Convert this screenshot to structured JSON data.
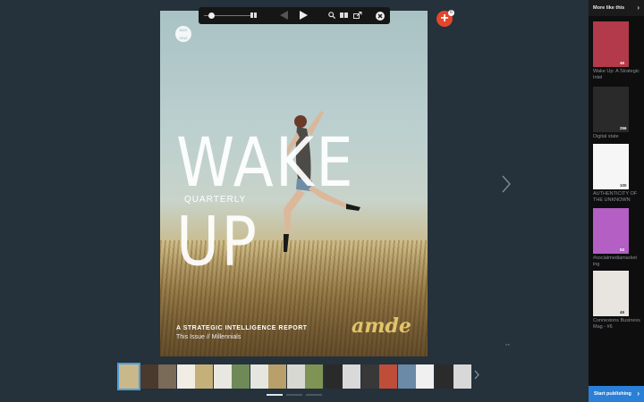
{
  "cover": {
    "date_badge": "AUG 2012",
    "title": "WAKE UP",
    "subtitle": "QUARTERLY",
    "footer_line1": "A STRATEGIC INTELLIGENCE REPORT",
    "footer_line2": "This Issue // Millennials",
    "brand": "amde"
  },
  "toolbar": {
    "icons": [
      "zoom-slider",
      "grid-icon",
      "prev-page-icon",
      "play-icon",
      "search-icon",
      "pages-icon",
      "share-icon",
      "close-icon"
    ]
  },
  "add_badge": "6",
  "thumbnails": {
    "count": 10,
    "colors": [
      [
        "#c9b889",
        "#c9b889"
      ],
      [
        "#4a3a2d",
        "#7a6a58"
      ],
      [
        "#f1ede4",
        "#c6b07a"
      ],
      [
        "#e9e7e1",
        "#6f8a58"
      ],
      [
        "#e6e6e0",
        "#b9a06a"
      ],
      [
        "#d8d8d2",
        "#7f9355"
      ],
      [
        "#2a2a2a",
        "#d9d9d9"
      ],
      [
        "#383838",
        "#bf4d3a"
      ],
      [
        "#6a8aa8",
        "#f0f0f0"
      ],
      [
        "#2b2b2b",
        "#d8d8d8"
      ]
    ],
    "pager_dots": 3
  },
  "sidebar": {
    "header": "More like this",
    "items": [
      {
        "title": "Wake Up: A Strategic Intel",
        "count": "46",
        "color": "#b33a4a"
      },
      {
        "title": "Digital state",
        "count": "256",
        "color": "#2a2a2a"
      },
      {
        "title": "AUTHENTICITY OF THE UNKNOWN",
        "count": "100",
        "color": "#f6f6f6"
      },
      {
        "title": "#socialmediamarket ing",
        "count": "53",
        "color": "#b35fc4"
      },
      {
        "title": "Connexions Business Mag - #6",
        "count": "46",
        "color": "#e8e4e0"
      }
    ],
    "cta": "Start publishing"
  },
  "colors": {
    "accent": "#2a7fd6",
    "add_button": "#e2472c",
    "background": "#25313b"
  }
}
